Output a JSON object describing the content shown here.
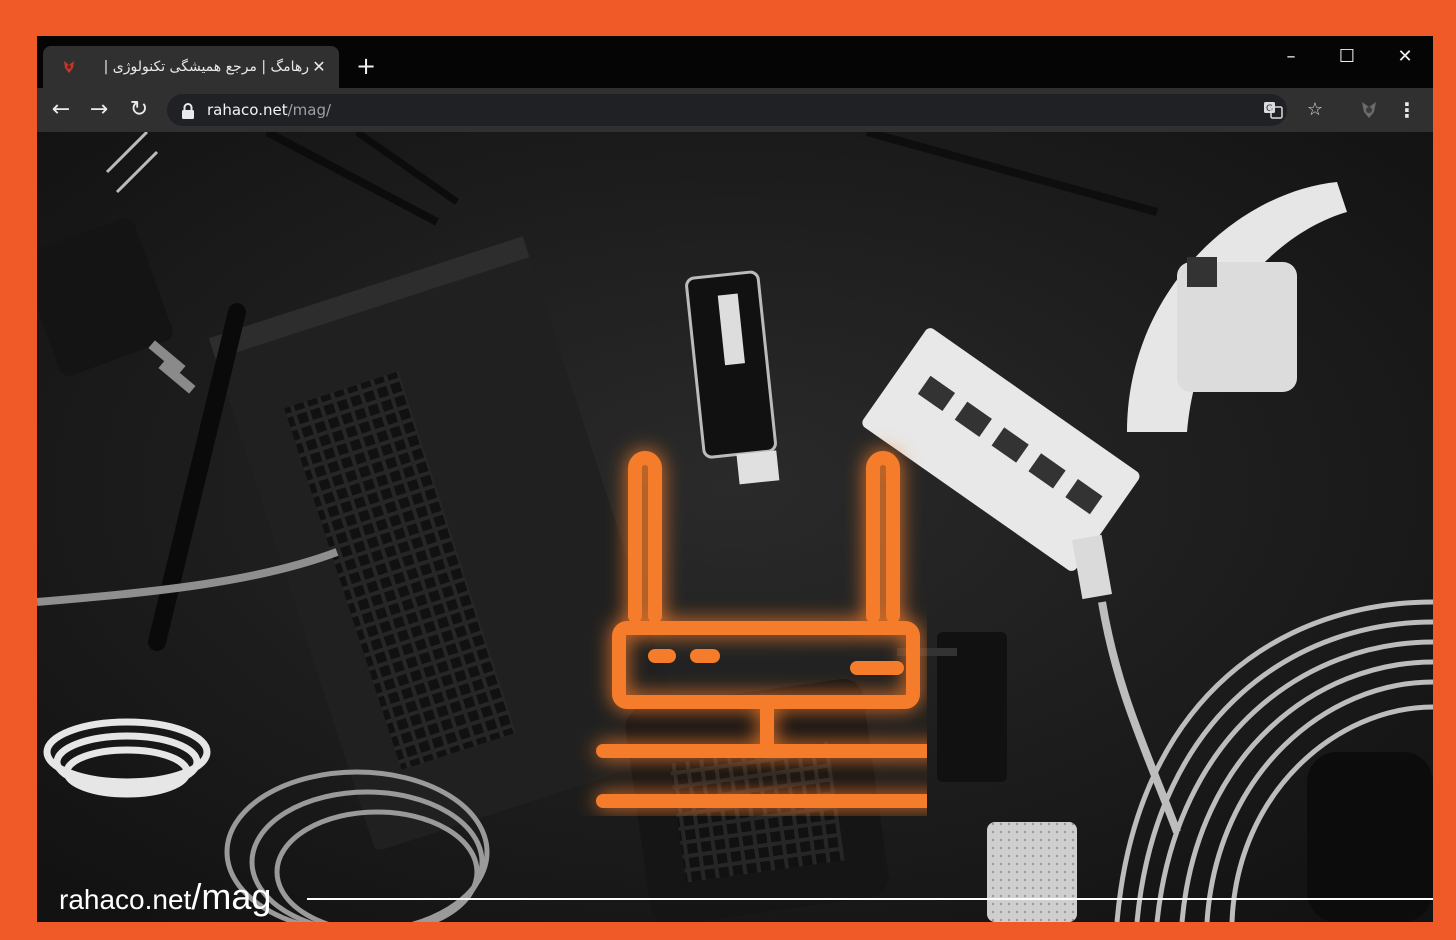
{
  "browser": {
    "tab": {
      "title": "رهامگ | مرجع همیشگی تکنولوژی |",
      "favicon": "rahaco-favicon-icon",
      "close_symbol": "✕"
    },
    "new_tab_symbol": "+",
    "window_controls": {
      "minimize": "–",
      "maximize": "☐",
      "close": "✕"
    },
    "nav": {
      "back": "←",
      "forward": "→",
      "reload": "↻"
    },
    "address": {
      "host": "rahaco.net",
      "path": "/mag/"
    },
    "icons": {
      "translate": "translate-icon",
      "bookmark": "star-icon",
      "extension": "extension-icon",
      "menu": "kebab-menu-icon"
    },
    "bookmark_symbol": "☆",
    "menu_symbol": "⋮"
  },
  "content": {
    "watermark": {
      "domain": "rahaco.net",
      "path": "/mag"
    },
    "logo": "router-icon",
    "colors": {
      "accent": "#f47c2a",
      "frame": "#f05a28"
    }
  }
}
